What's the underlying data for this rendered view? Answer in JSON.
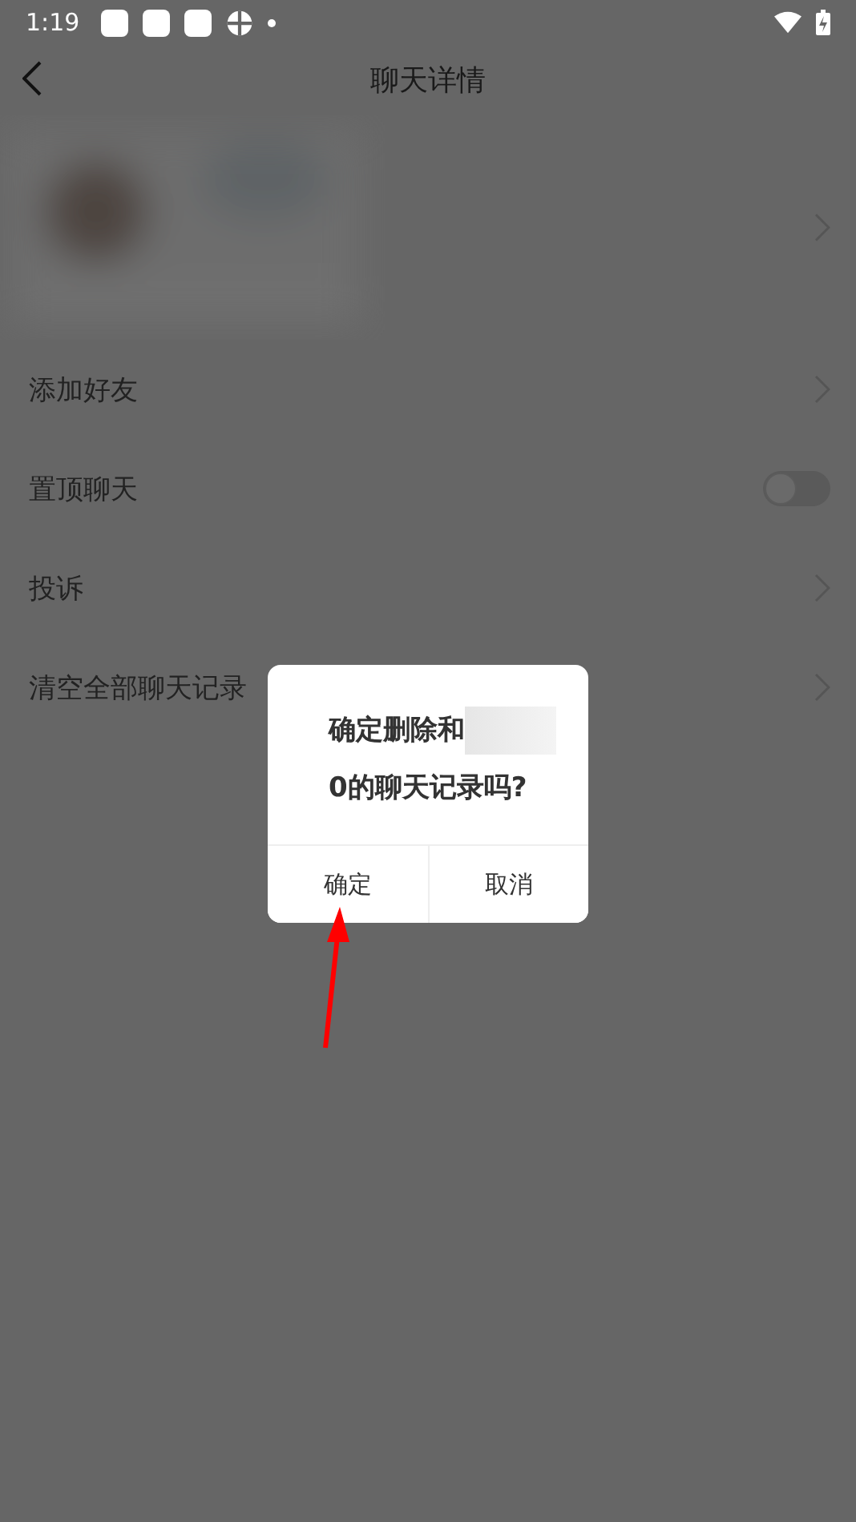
{
  "status_bar": {
    "time": "1:19"
  },
  "header": {
    "title": "聊天详情"
  },
  "menu": [
    {
      "label": "添加好友",
      "kind": "link"
    },
    {
      "label": "置顶聊天",
      "kind": "toggle",
      "on": false
    },
    {
      "label": "投诉",
      "kind": "link"
    },
    {
      "label": "清空全部聊天记录",
      "kind": "link"
    }
  ],
  "dialog": {
    "message_start": "确定删除和",
    "message_end": "0的聊天记录吗?",
    "buttons": [
      {
        "label": "确定"
      },
      {
        "label": "取消"
      }
    ]
  }
}
